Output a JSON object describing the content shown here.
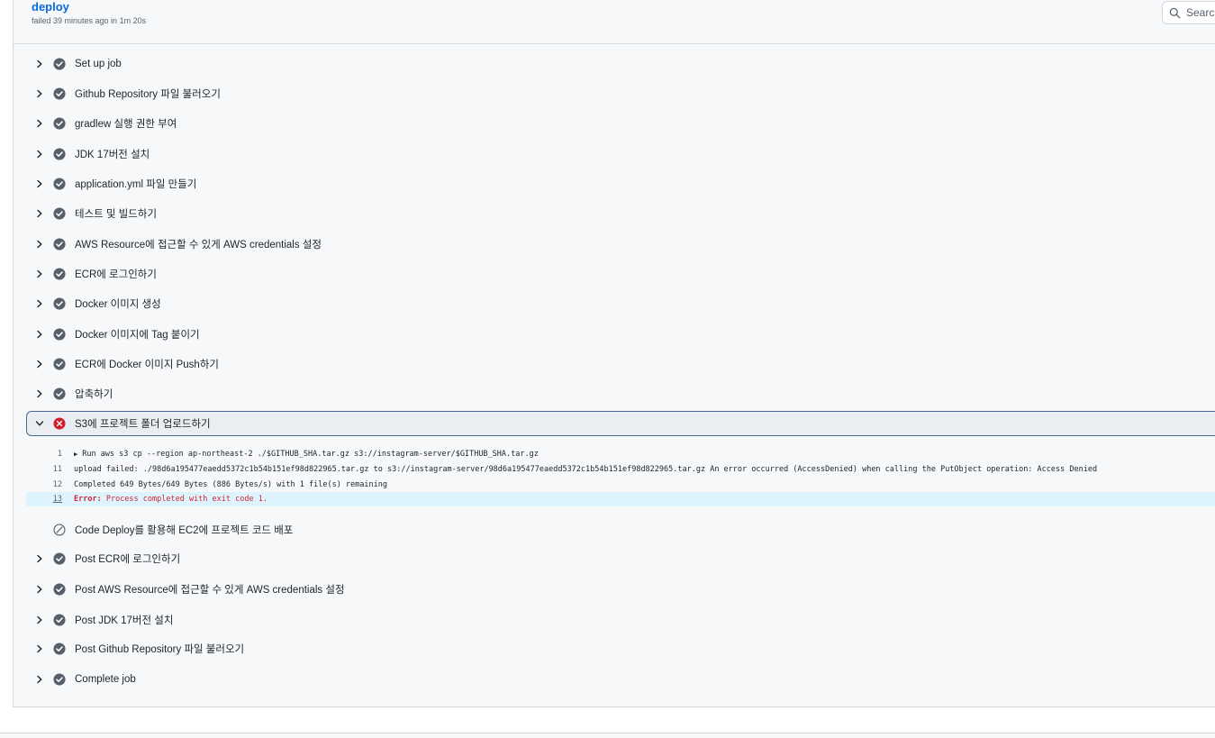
{
  "job": {
    "title": "deploy",
    "meta": "failed 39 minutes ago in 1m 20s"
  },
  "search": {
    "placeholder": "Search logs"
  },
  "colors": {
    "success": "#57606a",
    "failure": "#cf222e",
    "link": "#0969da"
  },
  "steps_before": [
    {
      "label": "Set up job",
      "status": "success"
    },
    {
      "label": "Github Repository 파일 불러오기",
      "status": "success"
    },
    {
      "label": "gradlew 실행 권한 부여",
      "status": "success"
    },
    {
      "label": "JDK 17버전 설치",
      "status": "success"
    },
    {
      "label": "application.yml 파일 만들기",
      "status": "success"
    },
    {
      "label": "테스트 및 빌드하기",
      "status": "success"
    },
    {
      "label": "AWS Resource에 접근할 수 있게 AWS credentials 설정",
      "status": "success"
    },
    {
      "label": "ECR에 로그인하기",
      "status": "success"
    },
    {
      "label": "Docker 이미지 생성",
      "status": "success"
    },
    {
      "label": "Docker 이미지에 Tag 붙이기",
      "status": "success"
    },
    {
      "label": "ECR에 Docker 이미지 Push하기",
      "status": "success"
    },
    {
      "label": "압축하기",
      "status": "success"
    }
  ],
  "failed_step": {
    "label": "S3에 프로젝트 폴더 업로드하기",
    "status": "failure",
    "log": [
      {
        "line": "1",
        "text": "Run aws s3 cp --region ap-northeast-2 ./$GITHUB_SHA.tar.gz s3://instagram-server/$GITHUB_SHA.tar.gz"
      },
      {
        "line": "11",
        "text": "upload failed: ./98d6a195477eaedd5372c1b54b151ef98d822965.tar.gz to s3://instagram-server/98d6a195477eaedd5372c1b54b151ef98d822965.tar.gz An error occurred (AccessDenied) when calling the PutObject operation: Access Denied"
      },
      {
        "line": "12",
        "text": "Completed 649 Bytes/649 Bytes (886 Bytes/s) with 1 file(s) remaining"
      },
      {
        "line": "13",
        "keyword": "Error:",
        "text": " Process completed with exit code 1."
      }
    ]
  },
  "steps_after": [
    {
      "label": "Code Deploy를 활용해 EC2에 프로젝트 코드 배포",
      "status": "skipped"
    },
    {
      "label": "Post ECR에 로그인하기",
      "status": "success"
    },
    {
      "label": "Post AWS Resource에 접근할 수 있게 AWS credentials 설정",
      "status": "success"
    },
    {
      "label": "Post JDK 17버전 설치",
      "status": "success"
    },
    {
      "label": "Post Github Repository 파일 불러오기",
      "status": "success"
    },
    {
      "label": "Complete job",
      "status": "success"
    }
  ]
}
